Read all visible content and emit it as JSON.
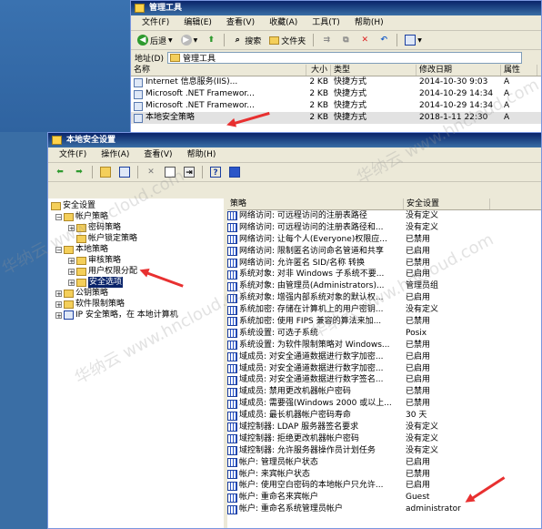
{
  "window1": {
    "title": "管理工具",
    "menu": [
      "文件(F)",
      "编辑(E)",
      "查看(V)",
      "收藏(A)",
      "工具(T)",
      "帮助(H)"
    ],
    "toolbar": {
      "back": "后退",
      "search": "搜索",
      "folders": "文件夹"
    },
    "address_label": "地址(D)",
    "address_value": "管理工具",
    "columns": [
      "名称",
      "大小",
      "类型",
      "修改日期",
      "属性"
    ],
    "rows": [
      {
        "name": "Internet 信息服务(IIS)...",
        "size": "2 KB",
        "type": "快捷方式",
        "date": "2014-10-30 9:03",
        "attr": "A"
      },
      {
        "name": "Microsoft .NET Framewor...",
        "size": "2 KB",
        "type": "快捷方式",
        "date": "2014-10-29 14:34",
        "attr": "A"
      },
      {
        "name": "Microsoft .NET Framewor...",
        "size": "2 KB",
        "type": "快捷方式",
        "date": "2014-10-29 14:34",
        "attr": "A"
      },
      {
        "name": "本地安全策略",
        "size": "2 KB",
        "type": "快捷方式",
        "date": "2018-1-11 22:30",
        "attr": "A"
      }
    ]
  },
  "window2": {
    "title": "本地安全设置",
    "menu": [
      "文件(F)",
      "操作(A)",
      "查看(V)",
      "帮助(H)"
    ],
    "tree": [
      {
        "label": "安全设置",
        "level": 0,
        "pm": "−"
      },
      {
        "label": "帐户策略",
        "level": 1,
        "pm": "−"
      },
      {
        "label": "密码策略",
        "level": 2,
        "pm": "+"
      },
      {
        "label": "帐户锁定策略",
        "level": 2,
        "pm": ""
      },
      {
        "label": "本地策略",
        "level": 1,
        "pm": "−"
      },
      {
        "label": "审核策略",
        "level": 2,
        "pm": "+"
      },
      {
        "label": "用户权限分配",
        "level": 2,
        "pm": "+"
      },
      {
        "label": "安全选项",
        "level": 2,
        "pm": "+",
        "selected": true
      },
      {
        "label": "公钥策略",
        "level": 1,
        "pm": "+"
      },
      {
        "label": "软件限制策略",
        "level": 1,
        "pm": "+"
      },
      {
        "label": "IP 安全策略，在 本地计算机",
        "level": 1,
        "pm": "+"
      }
    ],
    "detail_columns": [
      "策略",
      "安全设置"
    ],
    "policies": [
      {
        "name": "网络访问: 可远程访问的注册表路径",
        "value": "没有定义"
      },
      {
        "name": "网络访问: 可远程访问的注册表路径和...",
        "value": "没有定义"
      },
      {
        "name": "网络访问: 让每个人(Everyone)权限应...",
        "value": "已禁用"
      },
      {
        "name": "网络访问: 限制匿名访问命名管道和共享",
        "value": "已启用"
      },
      {
        "name": "网络访问: 允许匿名 SID/名称 转换",
        "value": "已禁用"
      },
      {
        "name": "系统对象: 对非 Windows 子系统不要...",
        "value": "已启用"
      },
      {
        "name": "系统对象: 由管理员(Administrators)...",
        "value": "管理员组"
      },
      {
        "name": "系统对象: 增强内部系统对象的默认权...",
        "value": "已启用"
      },
      {
        "name": "系统加密: 存储在计算机上的用户密钥...",
        "value": "没有定义"
      },
      {
        "name": "系统加密: 使用 FIPS 兼容的算法来加...",
        "value": "已禁用"
      },
      {
        "name": "系统设置: 可选子系统",
        "value": "Posix"
      },
      {
        "name": "系统设置: 为软件限制策略对 Windows...",
        "value": "已禁用"
      },
      {
        "name": "域成员: 对安全通道数据进行数字加密...",
        "value": "已启用"
      },
      {
        "name": "域成员: 对安全通道数据进行数字加密...",
        "value": "已启用"
      },
      {
        "name": "域成员: 对安全通道数据进行数字签名...",
        "value": "已启用"
      },
      {
        "name": "域成员: 禁用更改机器帐户密码",
        "value": "已禁用"
      },
      {
        "name": "域成员: 需要强(Windows 2000 或以上...",
        "value": "已禁用"
      },
      {
        "name": "域成员: 最长机器帐户密码寿命",
        "value": "30 天"
      },
      {
        "name": "域控制器: LDAP 服务器签名要求",
        "value": "没有定义"
      },
      {
        "name": "域控制器: 拒绝更改机器帐户密码",
        "value": "没有定义"
      },
      {
        "name": "域控制器: 允许服务器操作员计划任务",
        "value": "没有定义"
      },
      {
        "name": "帐户: 管理员帐户状态",
        "value": "已启用"
      },
      {
        "name": "帐户: 来宾帐户状态",
        "value": "已禁用"
      },
      {
        "name": "帐户: 使用空白密码的本地帐户只允许...",
        "value": "已启用"
      },
      {
        "name": "帐户: 重命名来宾帐户",
        "value": "Guest"
      },
      {
        "name": "帐户: 重命名系统管理员帐户",
        "value": "administrator"
      }
    ]
  },
  "watermark": "华纳云 www.hncloud.com",
  "colors": {
    "titlebar": "#0a246a",
    "arrow": "#e83030",
    "selection": "#0a246a"
  }
}
